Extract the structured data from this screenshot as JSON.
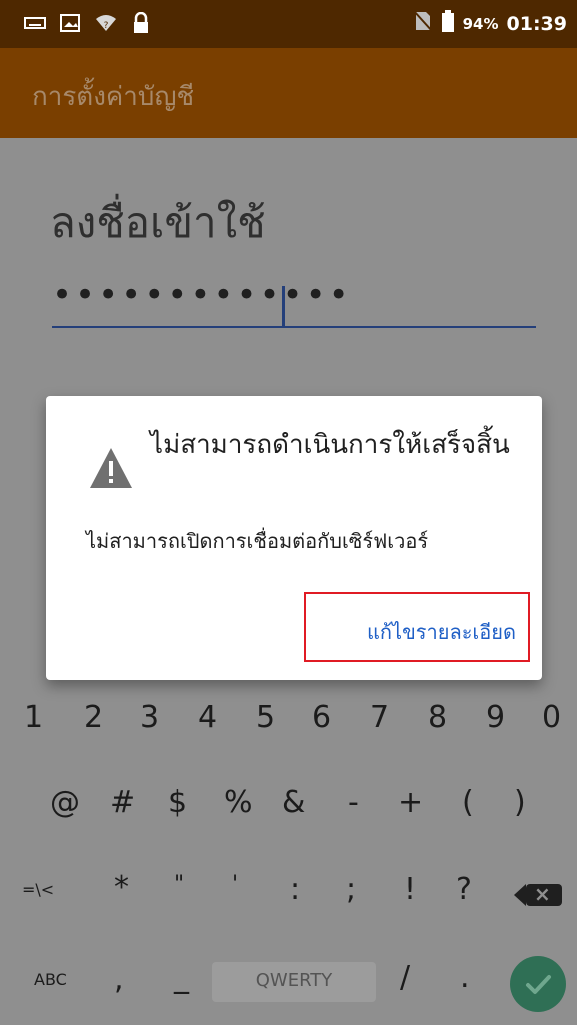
{
  "status_bar": {
    "battery_percent": "94%",
    "time": "01:39",
    "icons": [
      "keyboard-icon",
      "image-icon",
      "wifi-icon",
      "lock-icon",
      "no-sim-icon",
      "battery-icon"
    ]
  },
  "app_bar": {
    "title": "การตั้งค่าบัญชี"
  },
  "login": {
    "title": "ลงชื่อเข้าใช้",
    "password_masked": "•••••••••••••"
  },
  "dialog": {
    "title": "ไม่สามารถดำเนินการให้เสร็จสิ้น",
    "message": "ไม่สามารถเปิดการเชื่อมต่อกับเซิร์ฟเวอร์",
    "button_label": "แก้ไขรายละเอียด",
    "icon": "warning-icon",
    "highlight_color": "#e01b24",
    "button_color": "#1f5fc6"
  },
  "keyboard": {
    "row_numbers": [
      "1",
      "2",
      "3",
      "4",
      "5",
      "6",
      "7",
      "8",
      "9",
      "0"
    ],
    "row_symbols": [
      "@",
      "#",
      "$",
      "%",
      "&",
      "-",
      "+",
      "(",
      ")"
    ],
    "row_third": [
      "=\\<",
      "*",
      "\"",
      "'",
      ":",
      ";",
      "!",
      "?"
    ],
    "row_bottom": {
      "abc": "ABC",
      "comma": ",",
      "underscore": "_",
      "space_label": "QWERTY",
      "slash": "/",
      "period": "."
    }
  }
}
